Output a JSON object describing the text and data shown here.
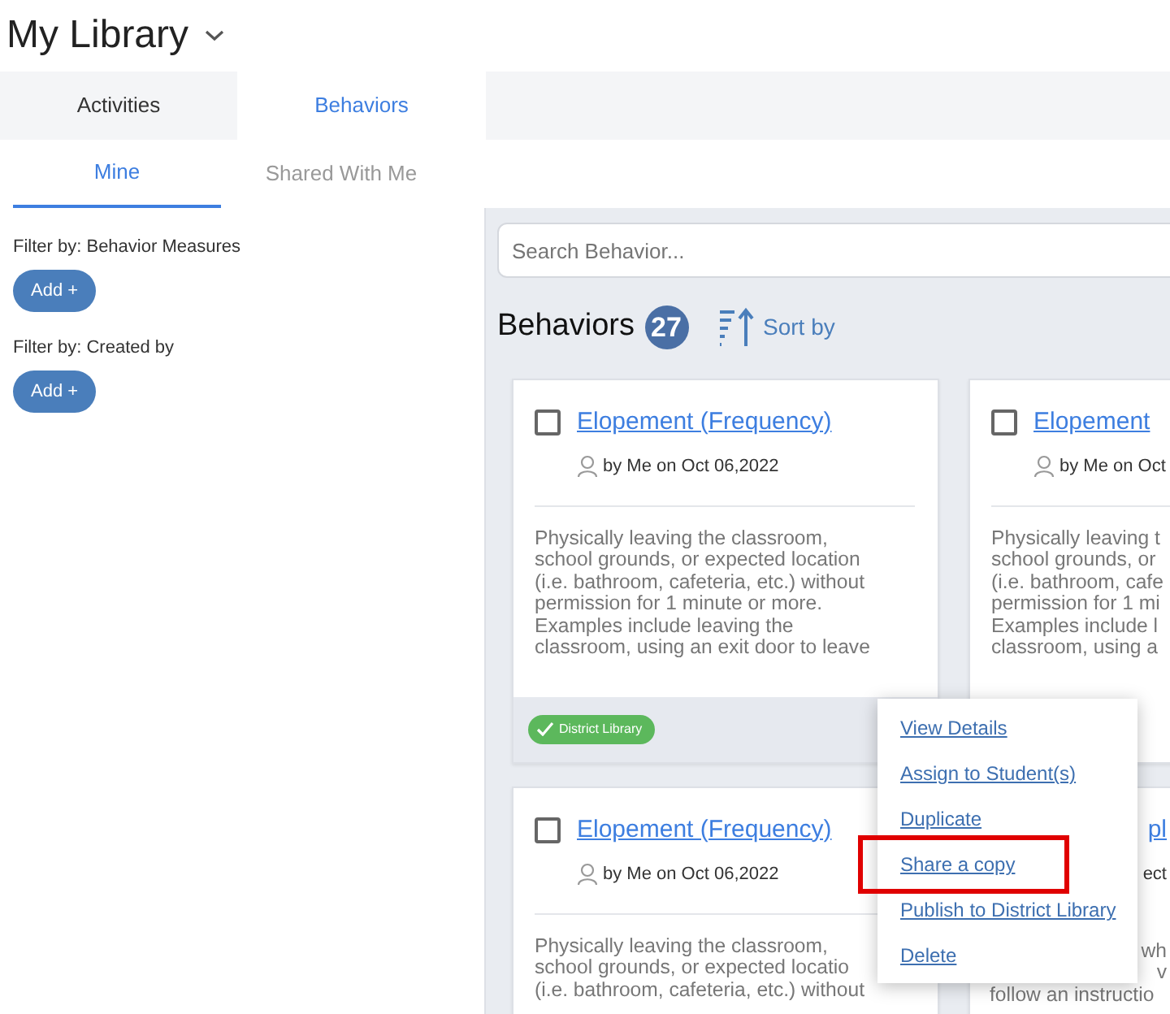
{
  "header": {
    "title": "My Library"
  },
  "tabs": [
    {
      "label": "Activities",
      "selected": false
    },
    {
      "label": "Behaviors",
      "selected": true
    }
  ],
  "subtabs": [
    {
      "label": "Mine",
      "selected": true
    },
    {
      "label": "Shared With Me",
      "selected": false
    }
  ],
  "filters": [
    {
      "label": "Filter by: Behavior Measures",
      "button": "Add +"
    },
    {
      "label": "Filter by: Created by",
      "button": "Add +"
    }
  ],
  "search": {
    "placeholder": "Search Behavior..."
  },
  "list_header": {
    "title": "Behaviors",
    "count": "27",
    "sort": "Sort by"
  },
  "cards": [
    {
      "kind": "full",
      "title": "Elopement (Frequency)",
      "checked": false,
      "meta": "by Me on Oct 06,2022",
      "description": [
        "Physically leaving the classroom,",
        "school grounds, or expected location",
        "(i.e. bathroom, cafeteria, etc.) without",
        "permission for 1 minute or more.",
        "Examples include leaving the",
        "classroom, using an exit door to leave"
      ],
      "tag": "District Library"
    },
    {
      "kind": "full",
      "title": "Elopement",
      "checked": false,
      "meta": "by Me on Oct",
      "description": [
        "Physically leaving t",
        "school grounds, or",
        "(i.e. bathroom, cafe",
        "permission for 1 mi",
        "Examples include l",
        "classroom, using a"
      ]
    },
    {
      "kind": "full",
      "title": "Elopement (Frequency)",
      "checked": false,
      "meta": "by Me on Oct 06,2022",
      "description": [
        "Physically leaving the classroom,",
        "school grounds, or expected locatio",
        "(i.e. bathroom, cafeteria, etc.) without"
      ]
    },
    {
      "kind": "covered",
      "title": "pl",
      "meta": "ect",
      "description": [
        "wh",
        "v",
        "follow an instructio"
      ]
    }
  ],
  "menu": {
    "items": [
      {
        "label": "View Details",
        "highlighted": false
      },
      {
        "label": "Assign to Student(s)",
        "highlighted": false
      },
      {
        "label": "Duplicate",
        "highlighted": false
      },
      {
        "label": "Share a copy",
        "highlighted": true
      },
      {
        "label": "Publish to District Library",
        "highlighted": false
      },
      {
        "label": "Delete",
        "highlighted": false
      }
    ]
  }
}
